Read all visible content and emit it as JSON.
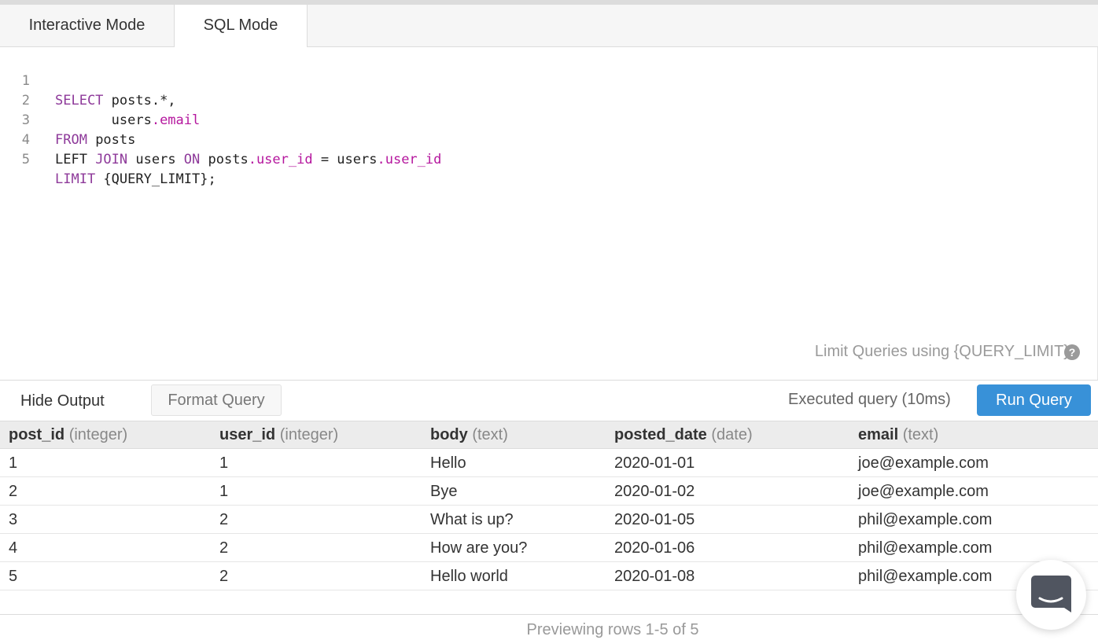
{
  "tabs": [
    {
      "label": "Interactive Mode"
    },
    {
      "label": "SQL Mode"
    }
  ],
  "editor": {
    "line_numbers": [
      "1",
      "2",
      "3",
      "4",
      "5"
    ],
    "hint": "Limit Queries using {QUERY_LIMIT}",
    "help_glyph": "?"
  },
  "toolbar": {
    "hide_label": "Hide Output",
    "format_label": "Format Query",
    "status": "Executed query (10ms)",
    "run_label": "Run Query"
  },
  "table": {
    "columns": [
      {
        "name": "post_id",
        "type": "(integer)"
      },
      {
        "name": "user_id",
        "type": "(integer)"
      },
      {
        "name": "body",
        "type": "(text)"
      },
      {
        "name": "posted_date",
        "type": "(date)"
      },
      {
        "name": "email",
        "type": "(text)"
      }
    ],
    "rows": [
      [
        "1",
        "1",
        "Hello",
        "2020-01-01",
        "joe@example.com"
      ],
      [
        "2",
        "1",
        "Bye",
        "2020-01-02",
        "joe@example.com"
      ],
      [
        "3",
        "2",
        "What is up?",
        "2020-01-05",
        "phil@example.com"
      ],
      [
        "4",
        "2",
        "How are you?",
        "2020-01-06",
        "phil@example.com"
      ],
      [
        "5",
        "2",
        "Hello world",
        "2020-01-08",
        "phil@example.com"
      ]
    ]
  },
  "footer": {
    "preview": "Previewing rows 1-5 of 5"
  },
  "code": {
    "l1_kw": "SELECT",
    "l1_rest": " posts.*,",
    "l2_pre": "       users",
    "l2_prop": ".email",
    "l3_kw": "FROM",
    "l3_rest": " posts",
    "l4_a": "LEFT ",
    "l4_kw1": "JOIN",
    "l4_b": " users ",
    "l4_kw2": "ON",
    "l4_c": " posts",
    "l4_prop1": ".user_id",
    "l4_d": " = users",
    "l4_prop2": ".user_id",
    "l5_kw": "LIMIT",
    "l5_rest": " {QUERY_LIMIT};"
  },
  "colors": {
    "keyword": "#8e3a9a",
    "property": "#b5179e",
    "run_button": "#3891d8"
  },
  "icons": {
    "help": "help-icon",
    "chat": "chat-icon"
  }
}
